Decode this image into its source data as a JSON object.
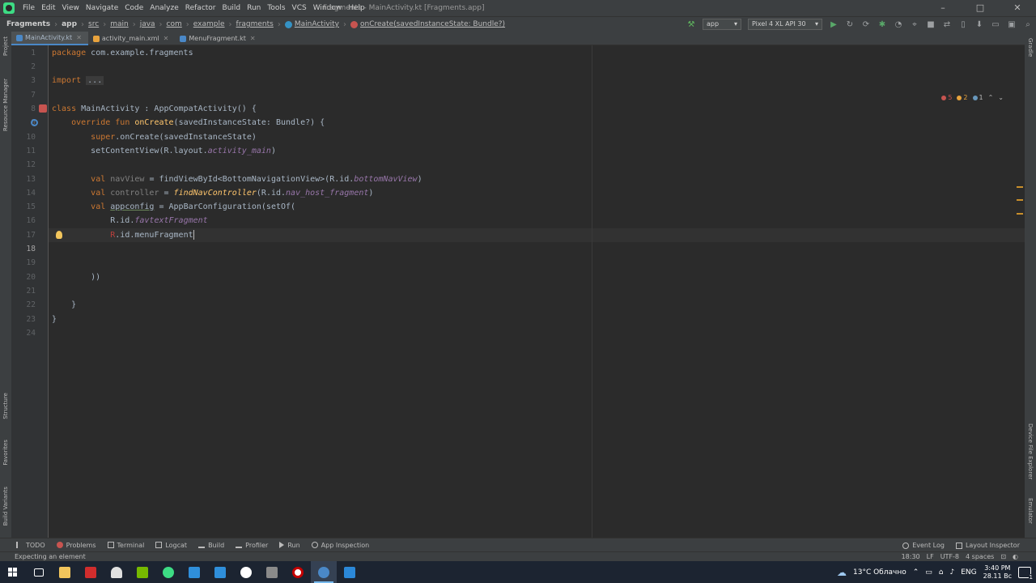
{
  "menubar": {
    "items": [
      "File",
      "Edit",
      "View",
      "Navigate",
      "Code",
      "Analyze",
      "Refactor",
      "Build",
      "Run",
      "Tools",
      "VCS",
      "Window",
      "Help"
    ],
    "title": "Fragments - MainActivity.kt [Fragments.app]"
  },
  "navbar": {
    "crumbs": [
      "Fragments",
      "app",
      "src",
      "main",
      "java",
      "com",
      "example",
      "fragments",
      "MainActivity",
      "onCreate(savedInstanceState: Bundle?)"
    ],
    "run_config": "app",
    "device": "Pixel 4 XL API 30"
  },
  "tabs": [
    {
      "label": "MainActivity.kt",
      "active": true,
      "color": "#4a88c7"
    },
    {
      "label": "activity_main.xml",
      "active": false,
      "color": "#e8a33d"
    },
    {
      "label": "MenuFragment.kt",
      "active": false,
      "color": "#4a88c7"
    }
  ],
  "left_tools": [
    "Project",
    "Resource Manager",
    "Structure",
    "Favorites",
    "Build Variants"
  ],
  "right_tools": [
    "Gradle",
    "Device File Explorer",
    "Emulator"
  ],
  "inspections": {
    "errors": "5",
    "warnings": "2",
    "weak": "1"
  },
  "editor": {
    "line_numbers": [
      "1",
      "2",
      "3",
      "7",
      "8",
      "9",
      "10",
      "11",
      "12",
      "13",
      "14",
      "15",
      "16",
      "17",
      "18",
      "19",
      "20",
      "21",
      "22",
      "23",
      "24"
    ],
    "current_line": "18"
  },
  "bottom_tools": [
    "TODO",
    "Problems",
    "Terminal",
    "Logcat",
    "Build",
    "Profiler",
    "Run",
    "App Inspection"
  ],
  "bottom_tools_right": [
    "Event Log",
    "Layout Inspector"
  ],
  "status": {
    "message": "Expecting an element",
    "position": "18:30",
    "line_sep": "LF",
    "encoding": "UTF-8",
    "indent": "4 spaces"
  },
  "taskbar": {
    "weather": "13°C Облачно",
    "lang": "ENG",
    "time": "3:40 PM",
    "date": "28.11 Вс",
    "notifications": "1"
  }
}
